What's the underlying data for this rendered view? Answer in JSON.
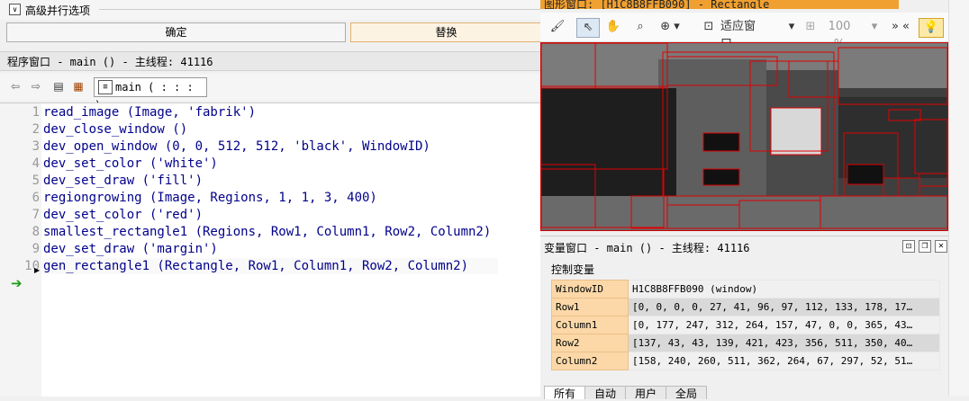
{
  "advanced": {
    "label": "高级并行选项"
  },
  "buttons": {
    "ok": "确定",
    "replace": "替换"
  },
  "program_window": {
    "title": "程序窗口 - main () - 主线程: 41116",
    "procedure": "main ( : : : )",
    "lines": [
      {
        "no": "1",
        "code": "read_image (Image, 'fabrik')"
      },
      {
        "no": "2",
        "code": "dev_close_window ()"
      },
      {
        "no": "3",
        "code": "dev_open_window (0, 0, 512, 512, 'black', WindowID)"
      },
      {
        "no": "4",
        "code": "dev_set_color ('white')"
      },
      {
        "no": "5",
        "code": "dev_set_draw ('fill')"
      },
      {
        "no": "6",
        "code": "regiongrowing (Image, Regions, 1, 1, 3, 400)"
      },
      {
        "no": "7",
        "code": "dev_set_color ('red')"
      },
      {
        "no": "8",
        "code": "smallest_rectangle1 (Regions, Row1, Column1, Row2, Column2)"
      },
      {
        "no": "9",
        "code": "dev_set_draw ('margin')"
      },
      {
        "no": "10",
        "code": "gen_rectangle1 (Rectangle, Row1, Column1, Row2, Column2)"
      }
    ]
  },
  "graphics_window": {
    "title": "图形窗口: [H1C8B8FFB090] - Rectangle",
    "fit_label": "适应窗口",
    "zoom": "100 %"
  },
  "variable_window": {
    "title": "变量窗口 - main () - 主线程: 41116",
    "section": "控制变量",
    "rows": [
      {
        "name": "WindowID",
        "value": "H1C8B8FFB090 (window)"
      },
      {
        "name": "Row1",
        "value": "[0, 0, 0, 0, 27, 41, 96, 97, 112, 133, 178, 17…"
      },
      {
        "name": "Column1",
        "value": "[0, 177, 247, 312, 264, 157, 47, 0, 0, 365, 43…"
      },
      {
        "name": "Row2",
        "value": "[137, 43, 43, 139, 421, 423, 356, 511, 350, 40…"
      },
      {
        "name": "Column2",
        "value": "[158, 240, 260, 511, 362, 264, 67, 297, 52, 51…"
      }
    ],
    "tabs": [
      "所有",
      "自动",
      "用户",
      "全局"
    ]
  }
}
